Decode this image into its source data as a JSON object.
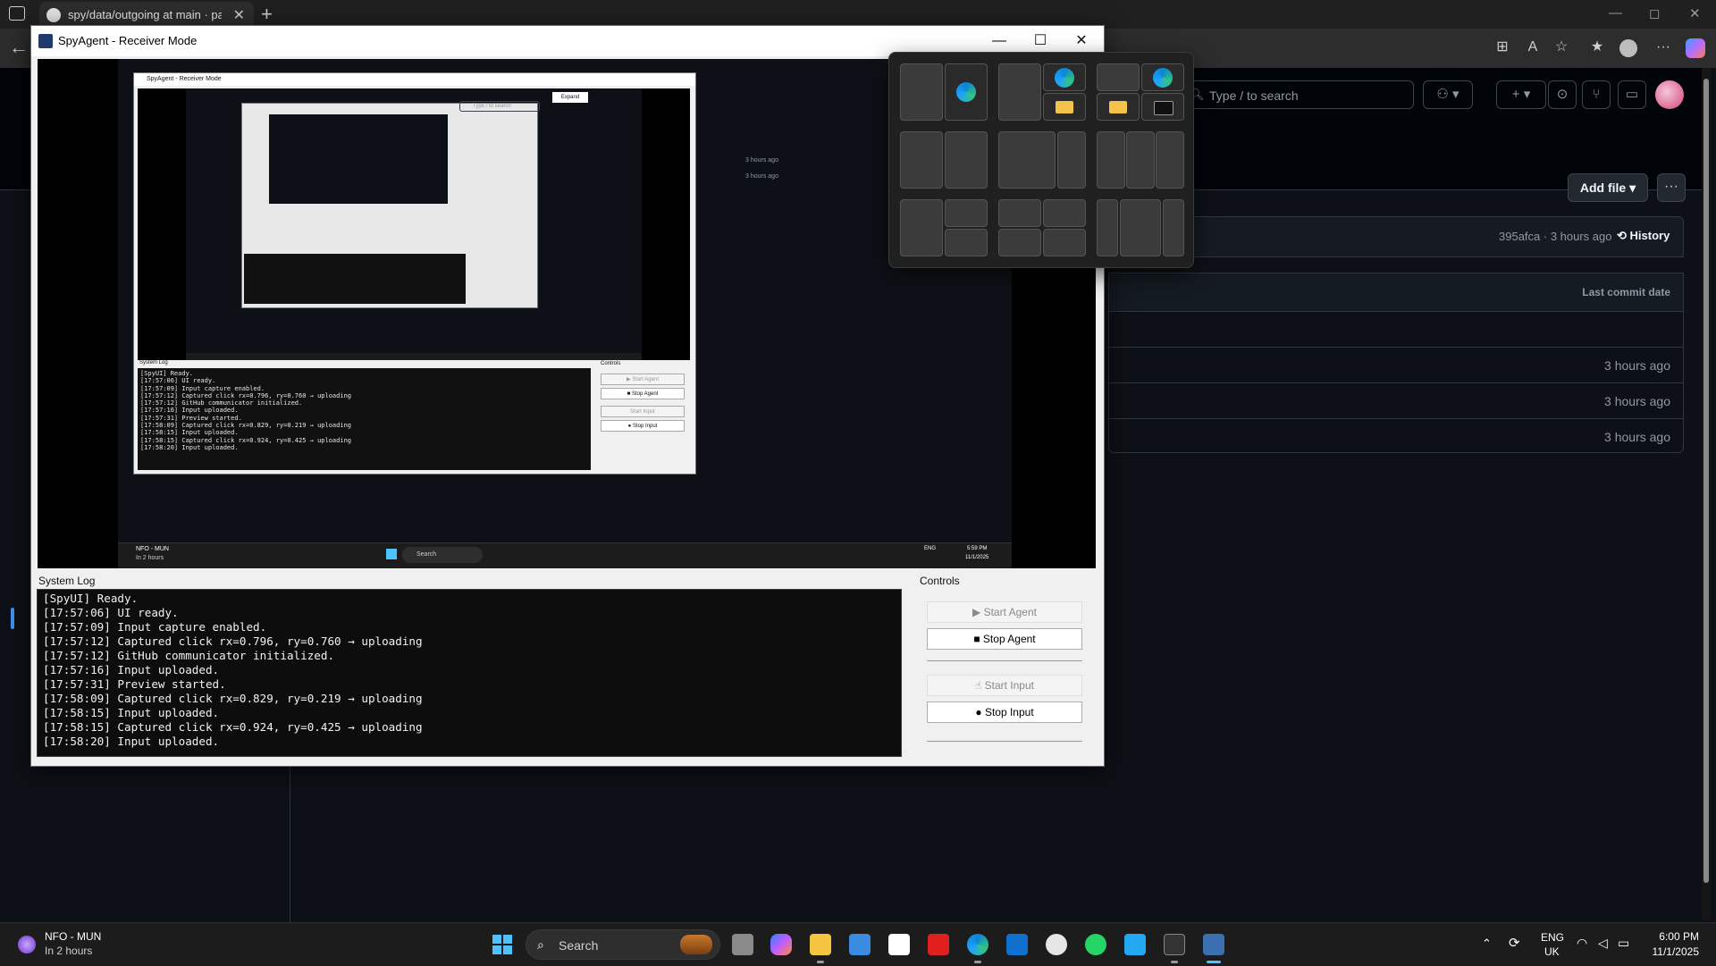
{
  "browser": {
    "tab_title": "spy/data/outgoing at main · pakc",
    "tab_close": "✕",
    "new_tab": "+",
    "back": "←",
    "window_controls": [
      "—",
      "◻",
      "✕"
    ]
  },
  "github": {
    "search_placeholder": "Type / to search",
    "add_file_label": "Add file ▾",
    "more_label": "···",
    "commit_meta": "395afca · 3 hours ago",
    "history_label": "History",
    "last_commit_header": "Last commit date",
    "rows": [
      {
        "age": "3 hours ago"
      },
      {
        "age": "3 hours ago"
      },
      {
        "age": "3 hours ago"
      }
    ]
  },
  "app": {
    "title": "SpyAgent - Receiver Mode",
    "controls": {
      "minimize": "—",
      "maximize": "☐",
      "close": "✕"
    },
    "system_log_label": "System Log",
    "controls_label": "Controls",
    "log_lines": [
      "[SpyUI] Ready.",
      "[17:57:06] UI ready.",
      "[17:57:09] Input capture enabled.",
      "[17:57:12] Captured click rx=0.796, ry=0.760 → uploading",
      "[17:57:12] GitHub communicator initialized.",
      "[17:57:16] Input uploaded.",
      "[17:57:31] Preview started.",
      "[17:58:09] Captured click rx=0.829, ry=0.219 → uploading",
      "[17:58:15] Input uploaded.",
      "[17:58:15] Captured click rx=0.924, ry=0.425 → uploading",
      "[17:58:20] Input uploaded."
    ],
    "buttons": {
      "start_agent": "▶ Start Agent",
      "stop_agent": "■ Stop Agent",
      "start_input": "Start Input",
      "stop_input": "Stop Input"
    }
  },
  "mini": {
    "title": "SpyAgent - Receiver Mode",
    "log_label": "System Log",
    "controls_label": "Controls",
    "start_agent": "▶ Start Agent",
    "stop_agent": "■ Stop Agent",
    "start_input": "Start Input",
    "stop_input": "● Stop Input",
    "search": "Type / to search",
    "expand": "Expand",
    "log_text": "[SpyUI] Ready.\n[17:57:06] UI ready.\n[17:57:09] Input capture enabled.\n[17:57:12] Captured click rx=0.796, ry=0.760 → uploading\n[17:57:12] GitHub communicator initialized.\n[17:57:16] Input uploaded.\n[17:57:31] Preview started.\n[17:58:09] Captured click rx=0.829, ry=0.219 → uploading\n[17:58:15] Input uploaded.\n[17:58:15] Captured click rx=0.924, ry=0.425 → uploading\n[17:58:20] Input uploaded.",
    "taskbar_weather": "NFO - MUN",
    "taskbar_weather_sub": "In 2 hours",
    "taskbar_search": "Search",
    "taskbar_lang": "ENG",
    "taskbar_time": "5:59 PM",
    "taskbar_date": "11/1/2025",
    "age": "3 hours ago"
  },
  "taskbar": {
    "weather_title": "NFO - MUN",
    "weather_sub": "In 2 hours",
    "search_label": "Search",
    "lang": "ENG",
    "region": "UK",
    "time": "6:00 PM",
    "date": "11/1/2025"
  }
}
